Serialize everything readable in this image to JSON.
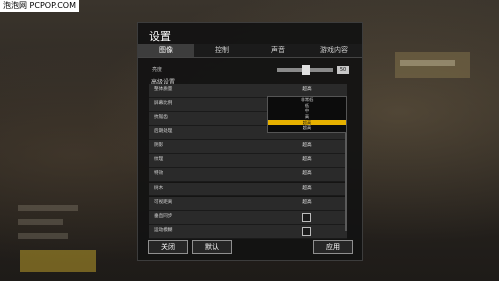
{
  "watermark": {
    "text": "泡泡网 PCPOP.COM"
  },
  "dialog": {
    "title": "设置",
    "tabs": [
      {
        "label": "图像",
        "active": true
      },
      {
        "label": "控制",
        "active": false
      },
      {
        "label": "声音",
        "active": false
      },
      {
        "label": "游戏内容",
        "active": false
      }
    ],
    "brightness": {
      "label": "亮度",
      "value_text": "50"
    },
    "advanced_title": "高级设置",
    "settings": [
      {
        "label": "整体质量",
        "value": "超高"
      },
      {
        "label": "屏幕比例",
        "value": ""
      },
      {
        "label": "抗锯齿",
        "value": ""
      },
      {
        "label": "后期处理",
        "value": "超高"
      },
      {
        "label": "阴影",
        "value": "超高"
      },
      {
        "label": "纹理",
        "value": "超高"
      },
      {
        "label": "特效",
        "value": "超高"
      },
      {
        "label": "树木",
        "value": "超高"
      },
      {
        "label": "可视距离",
        "value": "超高"
      },
      {
        "label": "垂直同步",
        "checkbox": true,
        "checked": false
      },
      {
        "label": "运动模糊",
        "checkbox": true,
        "checked": false
      }
    ],
    "dropdown": {
      "options": [
        "非常低",
        "低",
        "中",
        "高",
        "超高",
        "超高"
      ],
      "selected_index": 4,
      "highlight_color": "#e6b100"
    },
    "buttons": {
      "close": "关闭",
      "default": "默认",
      "apply": "应用"
    }
  }
}
